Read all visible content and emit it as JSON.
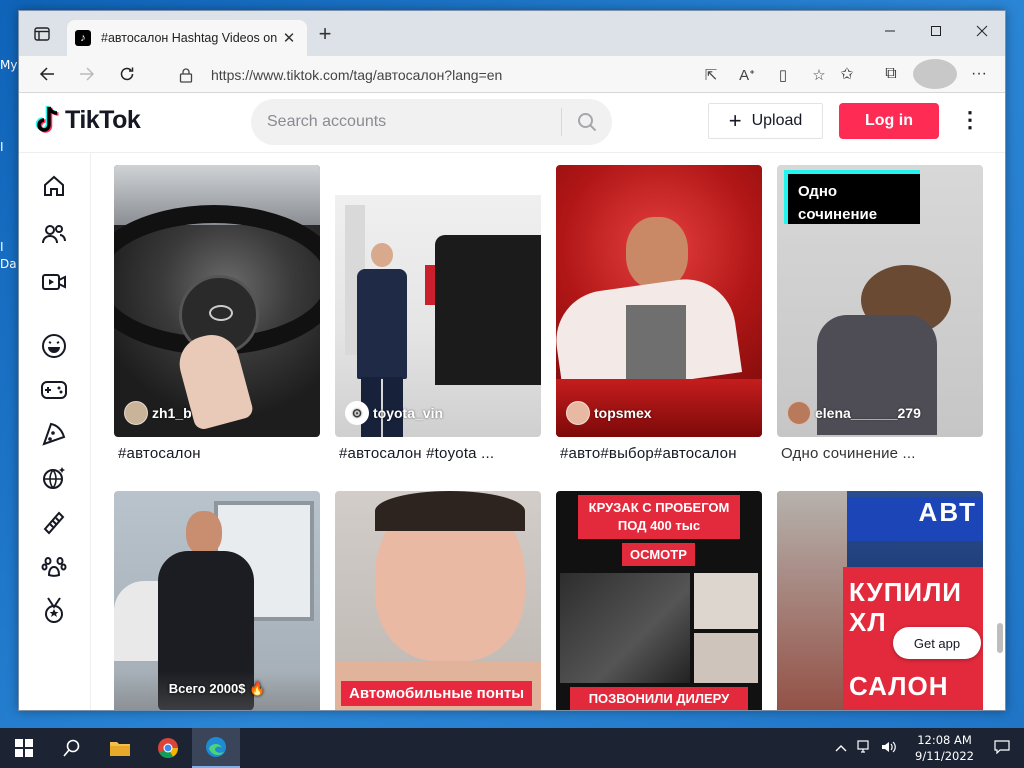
{
  "desktop": {
    "fragments": [
      "My",
      "I",
      "I",
      "Da"
    ]
  },
  "browser": {
    "tab_title": "#автосалон Hashtag Videos on T",
    "url": "https://www.tiktok.com/tag/автосалон?lang=en"
  },
  "tiktok": {
    "logo": "TikTok",
    "search_placeholder": "Search accounts",
    "upload_label": "Upload",
    "login_label": "Log in",
    "nav_icons": [
      "home-icon",
      "following-icon",
      "live-icon",
      "comedy-icon",
      "gaming-icon",
      "food-icon",
      "travel-icon",
      "beauty-icon",
      "animals-icon",
      "sports-icon"
    ],
    "videos": [
      {
        "author": "zh1_b",
        "caption": "#автосалон",
        "overlay": ""
      },
      {
        "author": "toyota_vin",
        "caption": "#автосалон #toyota ...",
        "overlay": ""
      },
      {
        "author": "topsmex",
        "caption": "#авто#выбор#автосалон",
        "overlay": ""
      },
      {
        "author": "elena______279",
        "caption": "Одно сочинение ...",
        "overlay": "Одно сочинение"
      },
      {
        "author": "",
        "caption": "",
        "overlay": "Всего 2000$ 🔥"
      },
      {
        "author": "",
        "caption": "",
        "overlay": "Автомобильные понты"
      },
      {
        "author": "",
        "caption": "",
        "overlay": "КРУЗАК С ПРОБЕГОМ ПОД 400 тыс",
        "overlay2": "ОСМОТР",
        "overlay3": "ПОЗВОНИЛИ ДИЛЕРУ"
      },
      {
        "author": "",
        "caption": "",
        "overlay": "КУПИЛИ ХЛ",
        "overlay2": "САЛОН",
        "sign": "АВТ",
        "get_app": "Get app"
      }
    ],
    "accent_color": "#fe2c55"
  },
  "taskbar": {
    "time": "12:08 AM",
    "date": "9/11/2022"
  }
}
